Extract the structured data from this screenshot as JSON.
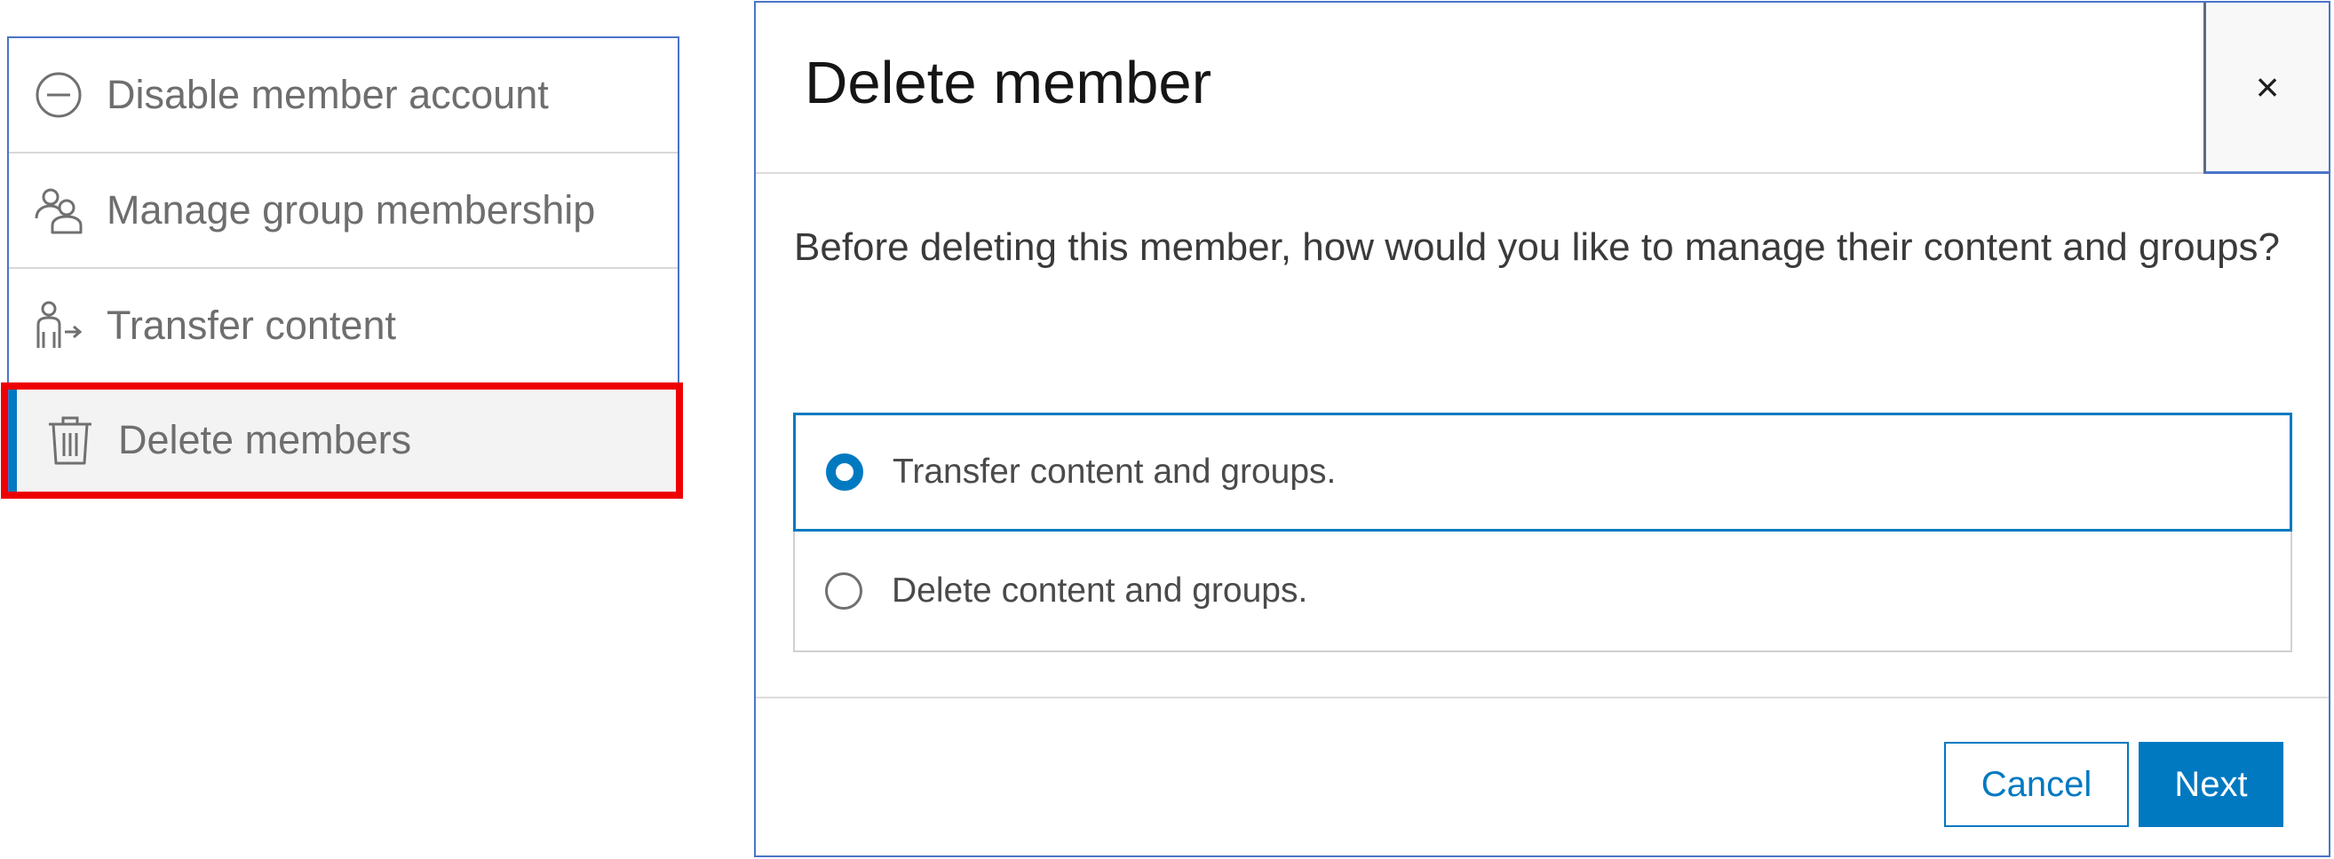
{
  "menu": {
    "items": [
      {
        "label": "Disable member account",
        "icon": "minus-circle-icon"
      },
      {
        "label": "Manage group membership",
        "icon": "users-icon"
      },
      {
        "label": "Transfer content",
        "icon": "user-transfer-icon"
      },
      {
        "label": "Delete members",
        "icon": "trash-icon",
        "selected": true
      }
    ],
    "highlight_color": "#ee0000"
  },
  "dialog": {
    "title": "Delete member",
    "close_label": "×",
    "question": "Before deleting this member, how would you like to manage their content and groups?",
    "options": [
      {
        "label": "Transfer content and groups.",
        "checked": true
      },
      {
        "label": "Delete content and groups.",
        "checked": false
      }
    ],
    "buttons": {
      "cancel": "Cancel",
      "next": "Next"
    }
  },
  "colors": {
    "accent": "#0079c1",
    "border_focus": "#4b74c9"
  }
}
